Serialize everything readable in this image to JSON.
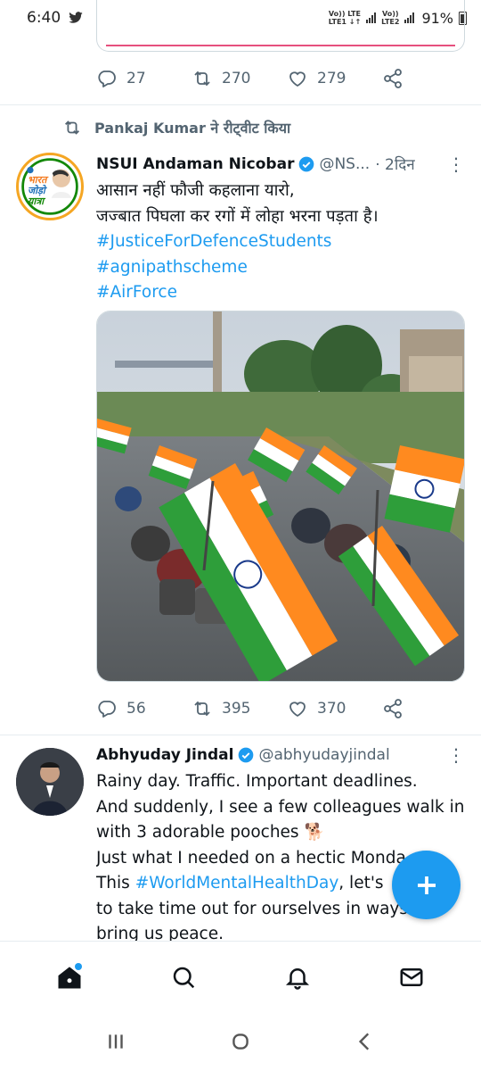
{
  "status_bar": {
    "time": "6:40",
    "net1_top": "Vo)) LTE",
    "net1_bottom": "LTE1 ↓↑",
    "net2_top": "Vo))",
    "net2_bottom": "LTE2",
    "battery": "91%"
  },
  "prev_tweet": {
    "replies": "27",
    "retweets": "270",
    "likes": "279"
  },
  "retweet_header": "Pankaj Kumar ने रीट्वीट किया",
  "tweet1": {
    "name": "NSUI Andaman Nicobar",
    "handle": "@NS...",
    "time": "· 2दिन",
    "line1": "आसान नहीं फौजी कहलाना यारो,",
    "line2": "जज्बात पिघला कर रगों में लोहा भरना पड़ता है।",
    "tags": [
      "#JusticeForDefenceStudents",
      "#agnipathscheme",
      "#AirForce"
    ],
    "avatar_text1": "भारत",
    "avatar_text2": "जोड़ो",
    "avatar_text3": "यात्रा",
    "replies": "56",
    "retweets": "395",
    "likes": "370"
  },
  "tweet2": {
    "name": "Abhyuday Jindal",
    "handle": "@abhyudayjindal",
    "line1": "Rainy day. Traffic. Important deadlines.",
    "line2": "And suddenly, I see a few colleagues walk in",
    "line3": "with 3 adorable pooches 🐕",
    "line4": "Just what I needed on a hectic Monda",
    "line5_pre": "This ",
    "line5_tag": "#WorldMentalHealthDay",
    "line5_post": ", let's",
    "line6": "to take time out for ourselves in ways",
    "line7": "bring us peace."
  },
  "colors": {
    "accent": "#1d9bf0",
    "muted": "#536471",
    "text": "#0f1419"
  },
  "icons": [
    "reply-icon",
    "retweet-icon",
    "like-icon",
    "share-icon",
    "verified-icon",
    "more-icon",
    "home-icon",
    "search-icon",
    "bell-icon",
    "mail-icon",
    "compose-icon"
  ]
}
